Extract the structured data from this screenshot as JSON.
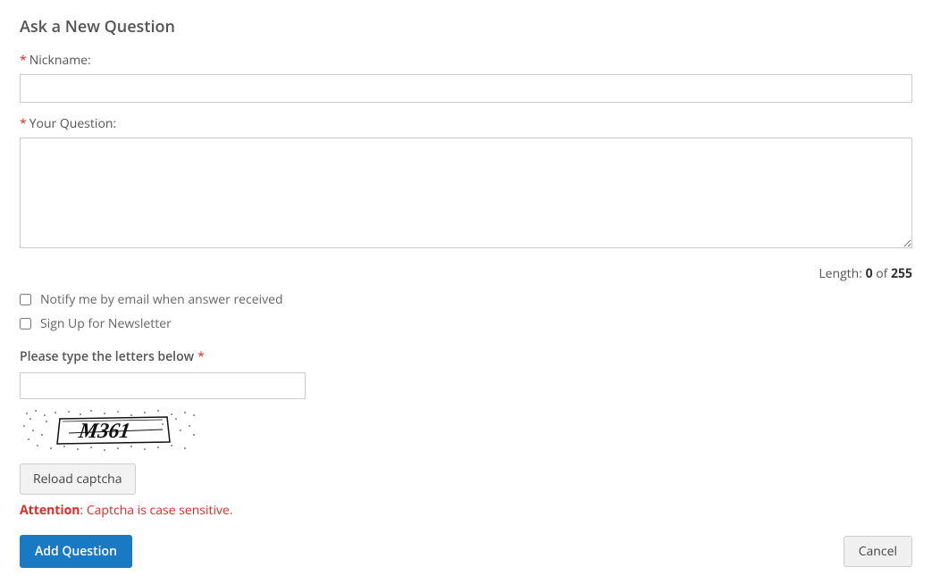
{
  "form": {
    "title": "Ask a New Question",
    "nickname": {
      "label": "Nickname:",
      "value": ""
    },
    "question": {
      "label": "Your Question:",
      "value": "",
      "length_prefix": "Length: ",
      "length_current": "0",
      "length_of": " of ",
      "length_max": "255"
    },
    "notify": {
      "label": "Notify me by email when answer received",
      "checked": false
    },
    "newsletter": {
      "label": "Sign Up for Newsletter",
      "checked": false
    },
    "captcha": {
      "label": "Please type the letters below",
      "value": "",
      "image_text": "M361",
      "reload_label": "Reload captcha",
      "attention_bold": "Attention",
      "attention_rest": ": Captcha is case sensitive."
    },
    "buttons": {
      "submit": "Add Question",
      "cancel": "Cancel"
    }
  }
}
